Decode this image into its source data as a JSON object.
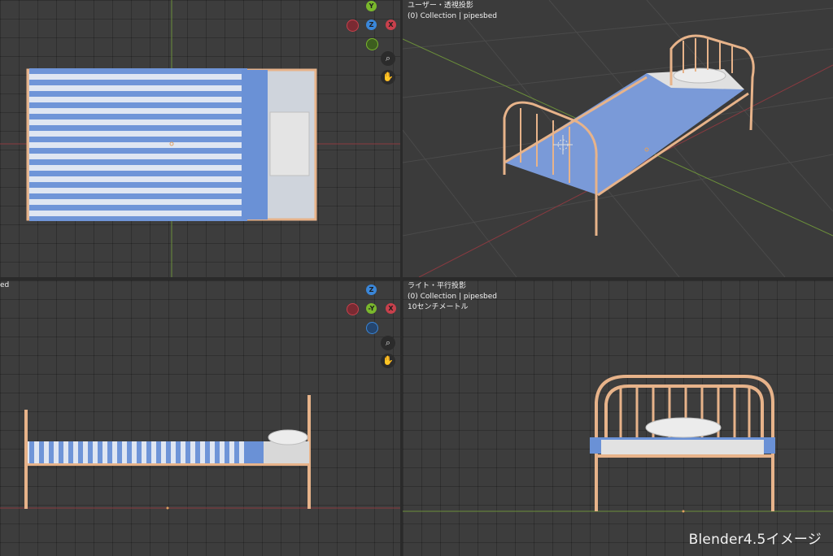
{
  "viewports": {
    "top_left": {
      "edge_label": ""
    },
    "top_right": {
      "view_name": "ユーザー・透視投影",
      "collection": "(0) Collection | pipesbed"
    },
    "bottom_left": {
      "edge_label": "ed"
    },
    "bottom_right": {
      "view_name": "ライト・平行投影",
      "collection": "(0) Collection | pipesbed",
      "scale": "10センチメートル"
    }
  },
  "gizmo_top": {
    "up": "Y",
    "center": "Z",
    "right": "X"
  },
  "gizmo_front": {
    "up": "Z",
    "center": "-Y",
    "right": "X"
  },
  "icons": {
    "zoom": "zoom-icon",
    "pan": "hand-pan-icon"
  },
  "watermark": "Blender4.5イメージ",
  "colors": {
    "x_axis": "#c8404c",
    "y_axis": "#7ab82c",
    "z_axis": "#3a86d8",
    "frame": "#e7b38a",
    "sheet_blue": "#6a91d6",
    "grid_line": "#2f2f2f"
  }
}
